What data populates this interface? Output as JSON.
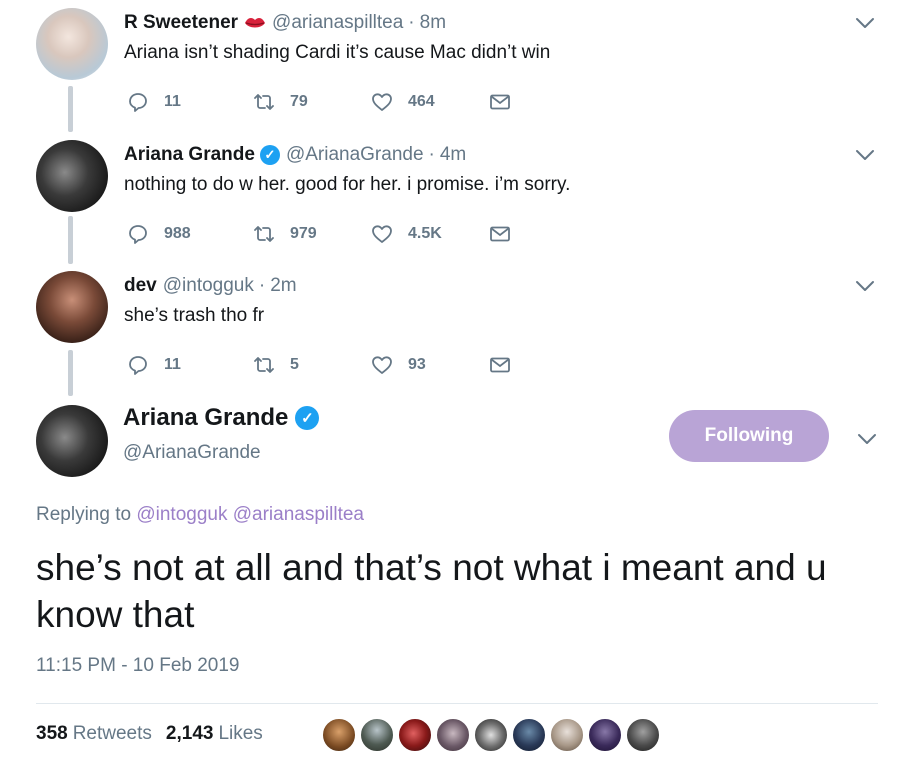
{
  "replies": [
    {
      "name": "R Sweetener",
      "name_emoji": "lips-icon",
      "handle": "@arianaspilltea",
      "separator": "·",
      "time": "8m",
      "text": "Ariana isn’t shading Cardi it’s cause Mac didn’t win",
      "replies": "11",
      "retweets": "79",
      "likes": "464"
    },
    {
      "name": "Ariana Grande",
      "verified": true,
      "handle": "@ArianaGrande",
      "separator": "·",
      "time": "4m",
      "text": "nothing to do w her. good for her. i promise. i’m sorry.",
      "replies": "988",
      "retweets": "979",
      "likes": "4.5K"
    },
    {
      "name": "dev",
      "handle": "@intogguk",
      "separator": "·",
      "time": "2m",
      "text": "she’s trash tho fr",
      "replies": "11",
      "retweets": "5",
      "likes": "93"
    }
  ],
  "main_tweet": {
    "name": "Ariana Grande",
    "verified": true,
    "handle": "@ArianaGrande",
    "follow_label": "Following",
    "replying_prefix": "Replying to",
    "replying_to": [
      "@intogguk",
      "@arianaspilltea"
    ],
    "text": "she’s not at all and that’s not what i meant and u know that",
    "timestamp": "11:15 PM - 10 Feb 2019",
    "retweets_count": "358",
    "retweets_label": "Retweets",
    "likes_count": "2,143",
    "likes_label": "Likes"
  },
  "colors": {
    "accent_purple": "#b9a4d6",
    "link_purple": "#9b7fc8",
    "verified_blue": "#1da1f2",
    "muted_text": "#657786"
  }
}
